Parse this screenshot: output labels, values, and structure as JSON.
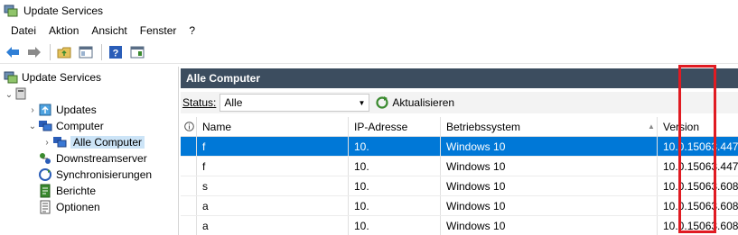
{
  "window": {
    "title": "Update Services"
  },
  "menu": [
    {
      "label": "Datei"
    },
    {
      "label": "Aktion"
    },
    {
      "label": "Ansicht"
    },
    {
      "label": "Fenster"
    },
    {
      "label": "?"
    }
  ],
  "tree": {
    "root": "Update Services",
    "items": [
      {
        "label": "Updates",
        "icon": "updates-icon"
      },
      {
        "label": "Computer",
        "icon": "computer-group-icon"
      },
      {
        "label": "Alle Computer",
        "icon": "computer-group-icon"
      },
      {
        "label": "Downstreamserver",
        "icon": "downstream-icon"
      },
      {
        "label": "Synchronisierungen",
        "icon": "sync-icon"
      },
      {
        "label": "Berichte",
        "icon": "reports-icon"
      },
      {
        "label": "Optionen",
        "icon": "options-icon"
      }
    ]
  },
  "panel": {
    "title": "Alle Computer",
    "status_label": "Status:",
    "status_value": "Alle",
    "refresh_label": "Aktualisieren"
  },
  "table": {
    "columns": [
      "Name",
      "IP-Adresse",
      "Betriebssystem",
      "Version"
    ],
    "rows": [
      {
        "name": "f",
        "ip": "10.",
        "os": "Windows 10",
        "version": "10.0.15063.447"
      },
      {
        "name": "f",
        "ip": "10.",
        "os": "Windows 10",
        "version": "10.0.15063.447"
      },
      {
        "name": "s",
        "ip": "10.",
        "os": "Windows 10",
        "version": "10.0.15063.608"
      },
      {
        "name": "a",
        "ip": "10.",
        "os": "Windows 10",
        "version": "10.0.15063.608"
      },
      {
        "name": "a",
        "ip": "10.",
        "os": "Windows 10",
        "version": "10.0.15063.608"
      }
    ]
  },
  "colors": {
    "header_bg": "#3c4d5f",
    "selection": "#0078d7",
    "highlight": "#e01b22"
  }
}
